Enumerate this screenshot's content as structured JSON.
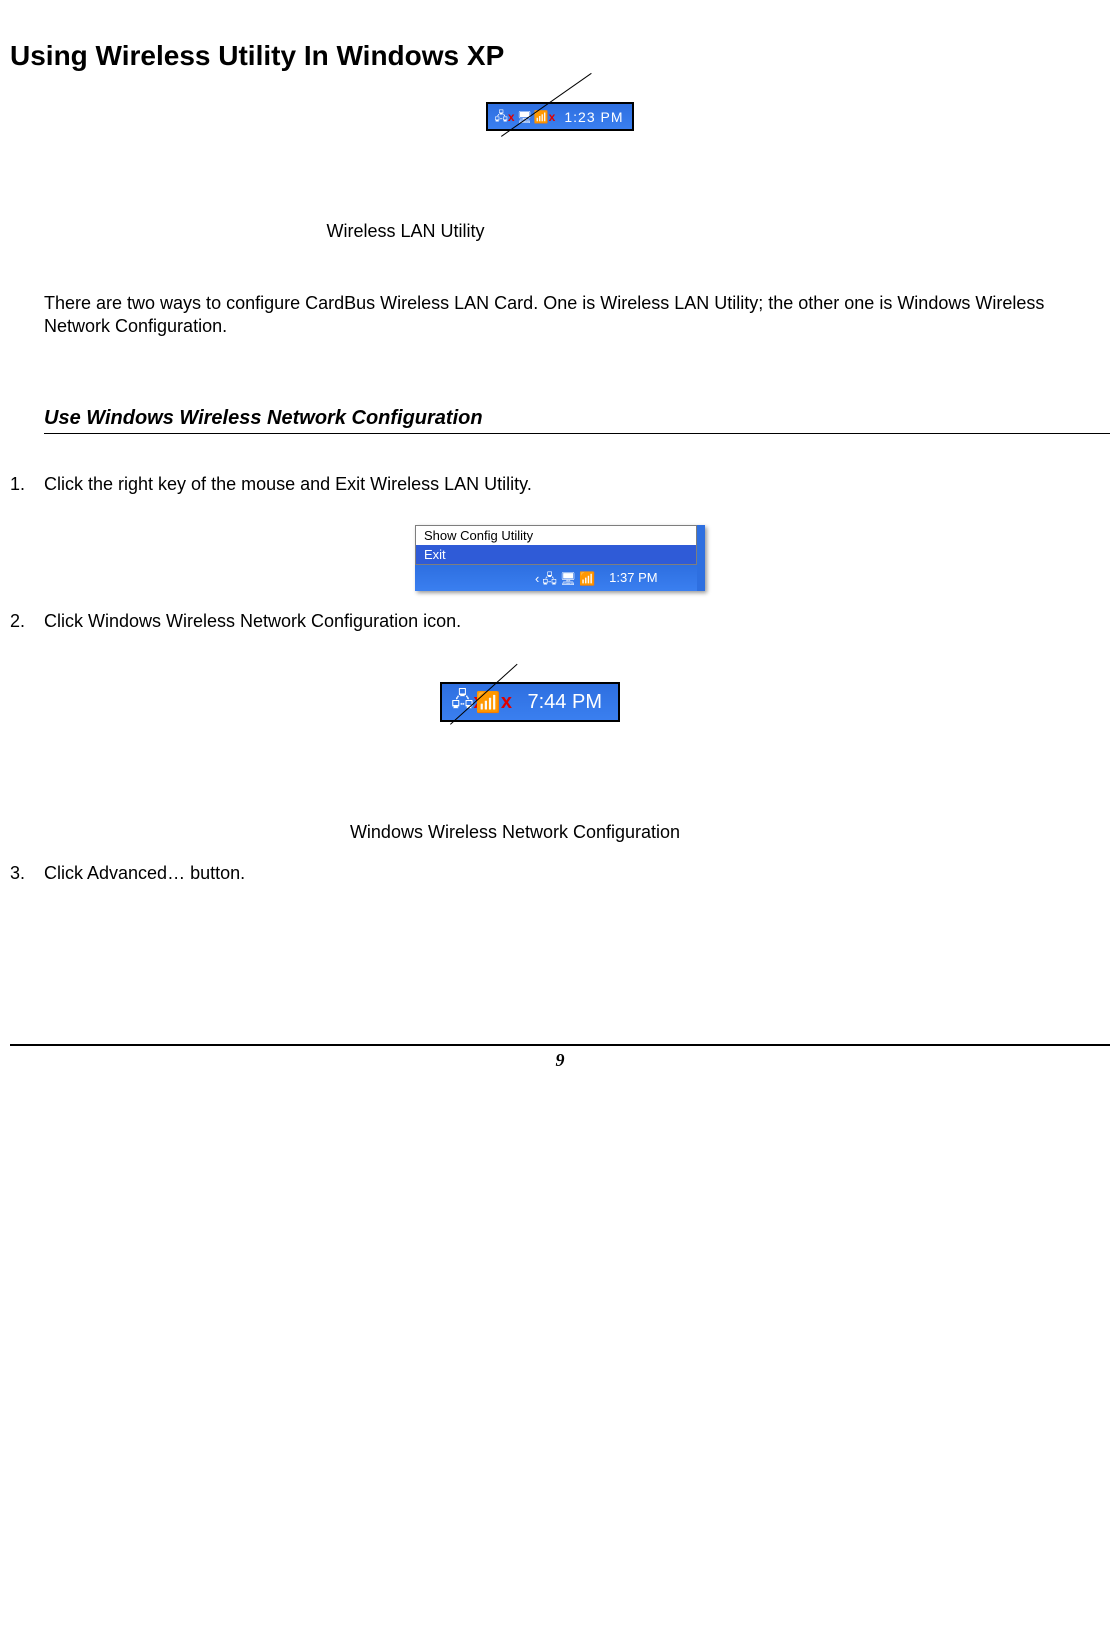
{
  "title": "Using Wireless Utility In Windows XP",
  "figure1": {
    "icons": [
      "network-disconnected-icon",
      "device-icon",
      "wireless-disconnected-icon"
    ],
    "time": "1:23 PM",
    "callout": "Wireless LAN Utility"
  },
  "intro_paragraph": "There are two ways to configure CardBus Wireless LAN Card. One is Wireless LAN Utility; the other one is Windows Wireless Network Configuration.",
  "section_heading": "Use Windows Wireless Network Configuration",
  "steps": [
    {
      "num": "1.",
      "text": "Click the right key of the mouse and Exit Wireless LAN Utility."
    },
    {
      "num": "2.",
      "text": "Click Windows Wireless Network Configuration icon."
    },
    {
      "num": "3.",
      "text": "Click Advanced… button."
    }
  ],
  "figure2": {
    "menu_items": [
      "Show Config Utility",
      "Exit"
    ],
    "selected_index": 1,
    "tray_time": "1:37 PM"
  },
  "figure3": {
    "icons": [
      "network-disconnected-icon",
      "wireless-disconnected-icon"
    ],
    "time": "7:44 PM",
    "callout": "Windows Wireless Network Configuration"
  },
  "page_number": "9"
}
